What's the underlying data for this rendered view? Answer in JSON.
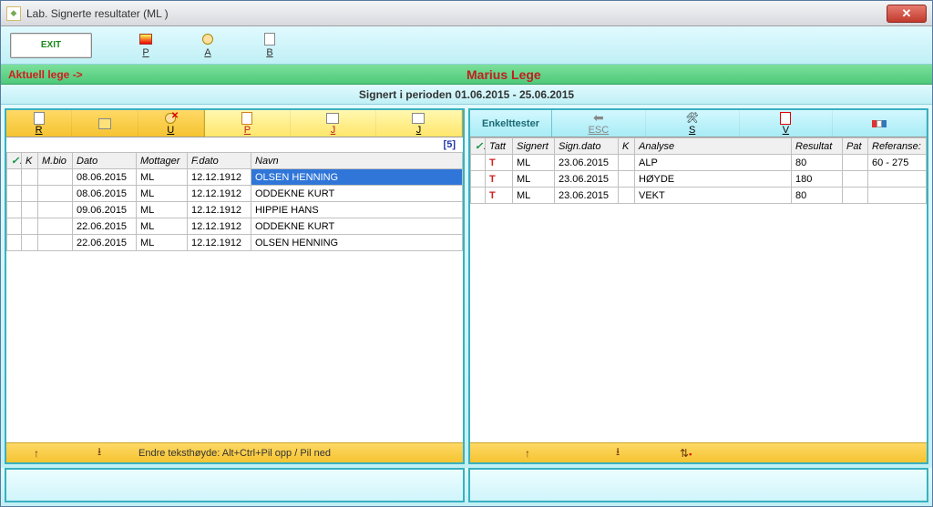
{
  "window": {
    "title": "Lab. Signerte resultater (ML  )"
  },
  "toolbar": {
    "exit_label": "EXIT",
    "items": [
      {
        "label": "P"
      },
      {
        "label": "A"
      },
      {
        "label": "B"
      }
    ]
  },
  "doctor_bar": {
    "label": "Aktuell lege ->",
    "name": "Marius Lege"
  },
  "period_bar": {
    "text": "Signert i perioden 01.06.2015 - 25.06.2015"
  },
  "left_pane": {
    "toolbar": {
      "group1": [
        {
          "label": "R"
        },
        {
          "label": ""
        },
        {
          "label": "U"
        }
      ],
      "group2": [
        {
          "label": "P"
        },
        {
          "label": "J"
        },
        {
          "label": "J"
        }
      ]
    },
    "count": "[5]",
    "columns": [
      "",
      "K",
      "M.bio",
      "Dato",
      "Mottager",
      "F.dato",
      "Navn"
    ],
    "rows": [
      {
        "k": "",
        "mbio": "",
        "dato": "08.06.2015",
        "mottager": "ML",
        "fdato": "12.12.1912",
        "navn": "OLSEN HENNING",
        "selected": true
      },
      {
        "k": "",
        "mbio": "",
        "dato": "08.06.2015",
        "mottager": "ML",
        "fdato": "12.12.1912",
        "navn": "ODDEKNE KURT"
      },
      {
        "k": "",
        "mbio": "",
        "dato": "09.06.2015",
        "mottager": "ML",
        "fdato": "12.12.1912",
        "navn": "HIPPIE HANS"
      },
      {
        "k": "",
        "mbio": "",
        "dato": "22.06.2015",
        "mottager": "ML",
        "fdato": "12.12.1912",
        "navn": "ODDEKNE KURT"
      },
      {
        "k": "",
        "mbio": "",
        "dato": "22.06.2015",
        "mottager": "ML",
        "fdato": "12.12.1912",
        "navn": "OLSEN HENNING"
      }
    ],
    "footer_hint": "Endre teksthøyde: Alt+Ctrl+Pil opp / Pil ned"
  },
  "right_pane": {
    "toolbar": {
      "tab_label": "Enkelttester",
      "buttons": [
        {
          "label": "ESC"
        },
        {
          "label": "S"
        },
        {
          "label": "V"
        },
        {
          "label": ""
        }
      ]
    },
    "columns": [
      "",
      "Tatt",
      "Signert",
      "Sign.dato",
      "K",
      "Analyse",
      "Resultat",
      "Pat",
      "Referanse:"
    ],
    "rows": [
      {
        "tatt": "T",
        "signert": "ML",
        "signdato": "23.06.2015",
        "k": "",
        "analyse": "ALP",
        "resultat": "80",
        "pat": "",
        "ref": "60 - 275"
      },
      {
        "tatt": "T",
        "signert": "ML",
        "signdato": "23.06.2015",
        "k": "",
        "analyse": "HØYDE",
        "resultat": "180",
        "pat": "",
        "ref": ""
      },
      {
        "tatt": "T",
        "signert": "ML",
        "signdato": "23.06.2015",
        "k": "",
        "analyse": "VEKT",
        "resultat": "80",
        "pat": "",
        "ref": ""
      }
    ]
  }
}
